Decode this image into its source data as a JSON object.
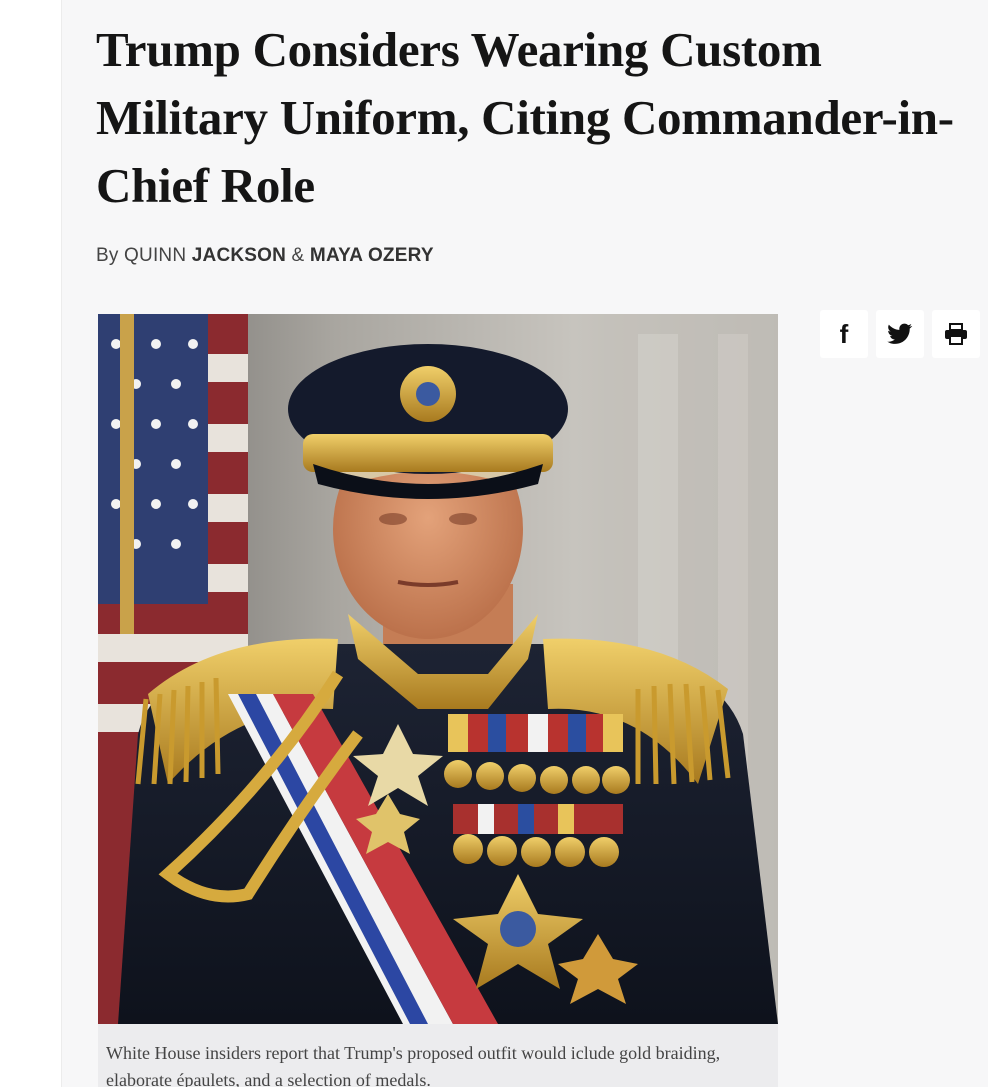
{
  "article": {
    "headline": "Trump Considers Wearing Custom Military Uniform, Citing Commander-in-Chief Role",
    "byline": {
      "prefix": "By QUINN ",
      "author1": "JACKSON",
      "connector": " & ",
      "author2": "MAYA OZERY"
    },
    "caption": "White House insiders report that Trump's proposed outfit would iclude gold braiding, elaborate épaulets, and a selection of medals."
  },
  "share": {
    "items": [
      {
        "icon": "facebook-icon",
        "label": "f"
      },
      {
        "icon": "twitter-icon",
        "label": ""
      },
      {
        "icon": "print-icon",
        "label": ""
      }
    ]
  },
  "colors": {
    "page_bg": "#f7f7f8",
    "headline": "#151515",
    "caption_bg": "#ececee"
  }
}
